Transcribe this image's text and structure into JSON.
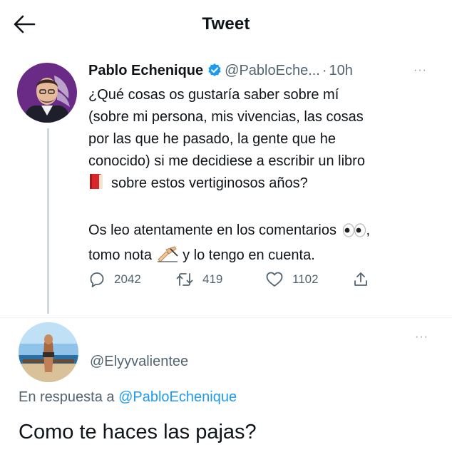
{
  "header": {
    "title": "Tweet",
    "back_icon": "arrow-left-icon"
  },
  "tweet": {
    "author_name": "Pablo Echenique",
    "handle": "@PabloEche...",
    "separator": "·",
    "time": "10h",
    "more_label": "···",
    "lines": [
      "¿Qué cosas os gustaría saber sobre mí",
      "(sobre mi persona, mis vivencias, las cosas",
      "por las que he pasado, la gente que he",
      "conocido) si me decidiese a escribir un libro",
      "sobre estos vertiginosos años?"
    ],
    "line2_a": "Os leo atentamente en los comentarios",
    "line2_b": ",",
    "line3_a": "tomo nota",
    "line3_b": "y lo tengo en cuenta.",
    "emojis": [
      "book-icon",
      "eyes-icon",
      "writing-hand-icon"
    ],
    "stats": {
      "replies": "2042",
      "retweets": "419",
      "likes": "1102"
    }
  },
  "reply": {
    "handle": "@Elyyvalientee",
    "more_label": "···",
    "in_reply_to_label": "En respuesta a",
    "in_reply_to_mention": "@PabloEchenique",
    "text": "Como te haces las pajas?"
  },
  "colors": {
    "text": "#0f1419",
    "secondary": "#536471",
    "link": "#1d9bf0",
    "verified": "#1d9bf0",
    "line": "#cfd9de"
  }
}
